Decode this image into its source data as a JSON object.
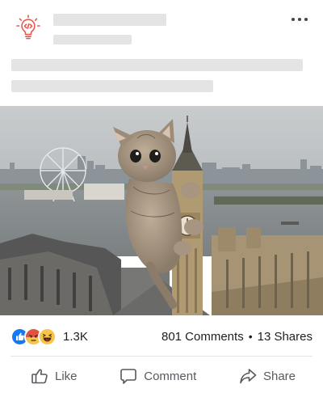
{
  "post": {
    "author_icon": "lightbulb-code-icon",
    "photo_alt": "Giant kitten climbing Big Ben in London"
  },
  "stats": {
    "reaction_icons": [
      "like-icon",
      "angry-icon",
      "haha-icon"
    ],
    "reaction_count": "1.3K",
    "comments": "801 Comments",
    "separator": "•",
    "shares": "13 Shares"
  },
  "actions": {
    "like": "Like",
    "comment": "Comment",
    "share": "Share"
  },
  "colors": {
    "accent": "#e8574e",
    "like_blue": "#1877f2",
    "angry_red": "#e0533c",
    "haha_yellow": "#f7c54a",
    "placeholder": "#e4e4e4",
    "action_text": "#555a60"
  }
}
